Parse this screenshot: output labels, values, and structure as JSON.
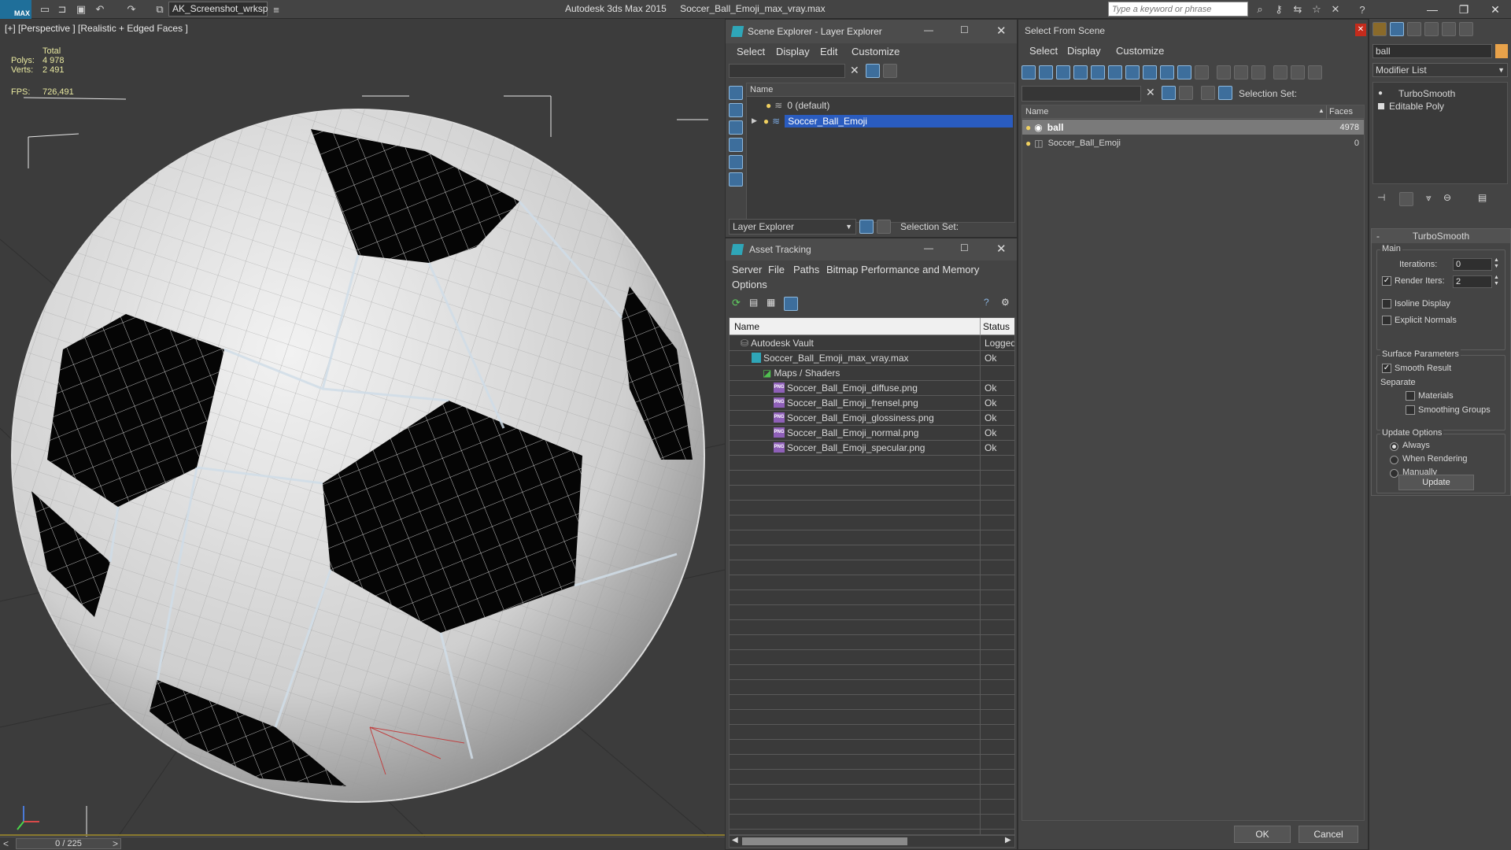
{
  "titlebar": {
    "app_logo": "MAX",
    "workspace": "AK_Screenshot_wrksp",
    "app_title": "Autodesk 3ds Max  2015",
    "file_title": "Soccer_Ball_Emoji_max_vray.max",
    "search_placeholder": "Type a keyword or phrase"
  },
  "viewport": {
    "label": "[+] [Perspective ] [Realistic + Edged Faces ]",
    "stats": {
      "total_label": "Total",
      "polys_label": "Polys:",
      "polys": "4 978",
      "verts_label": "Verts:",
      "verts": "2 491",
      "fps_label": "FPS:",
      "fps": "726,491"
    },
    "timeline": "0 / 225",
    "timeline_prev": "<",
    "timeline_next": ">"
  },
  "scene_explorer": {
    "title": "Scene Explorer - Layer Explorer",
    "menu": [
      "Select",
      "Display",
      "Edit",
      "Customize"
    ],
    "col_name": "Name",
    "layers": [
      "0 (default)",
      "Soccer_Ball_Emoji"
    ],
    "footer_dropdown": "Layer Explorer",
    "selection_set_label": "Selection Set:"
  },
  "asset_tracking": {
    "title": "Asset Tracking",
    "menu": [
      "Server",
      "File",
      "Paths",
      "Bitmap Performance and Memory",
      "Options"
    ],
    "col_name": "Name",
    "col_status": "Status",
    "rows": [
      {
        "name": "Autodesk Vault",
        "status": "Logged",
        "indent": 0,
        "kind": "vault"
      },
      {
        "name": "Soccer_Ball_Emoji_max_vray.max",
        "status": "Ok",
        "indent": 1,
        "kind": "max"
      },
      {
        "name": "Maps / Shaders",
        "status": "",
        "indent": 2,
        "kind": "maps"
      },
      {
        "name": "Soccer_Ball_Emoji_diffuse.png",
        "status": "Ok",
        "indent": 3,
        "kind": "png"
      },
      {
        "name": "Soccer_Ball_Emoji_frensel.png",
        "status": "Ok",
        "indent": 3,
        "kind": "png"
      },
      {
        "name": "Soccer_Ball_Emoji_glossiness.png",
        "status": "Ok",
        "indent": 3,
        "kind": "png"
      },
      {
        "name": "Soccer_Ball_Emoji_normal.png",
        "status": "Ok",
        "indent": 3,
        "kind": "png"
      },
      {
        "name": "Soccer_Ball_Emoji_specular.png",
        "status": "Ok",
        "indent": 3,
        "kind": "png"
      }
    ]
  },
  "select_from_scene": {
    "title": "Select From Scene",
    "menu": [
      "Select",
      "Display",
      "Customize"
    ],
    "selection_set_label": "Selection Set:",
    "col_name": "Name",
    "col_faces": "Faces",
    "rows": [
      {
        "name": "ball",
        "faces": "4978"
      },
      {
        "name": "Soccer_Ball_Emoji",
        "faces": "0"
      }
    ],
    "ok_label": "OK",
    "cancel_label": "Cancel"
  },
  "modify_panel": {
    "object_name": "ball",
    "modifier_list_label": "Modifier List",
    "stack": [
      "TurboSmooth",
      "Editable Poly"
    ],
    "rollout_title": "TurboSmooth",
    "main_label": "Main",
    "iterations_label": "Iterations:",
    "iterations": "0",
    "render_iters_label": "Render Iters:",
    "render_iters": "2",
    "isoline_label": "Isoline Display",
    "explicit_normals_label": "Explicit Normals",
    "surface_params_label": "Surface Parameters",
    "smooth_result_label": "Smooth Result",
    "separate_label": "Separate",
    "materials_label": "Materials",
    "smoothing_groups_label": "Smoothing Groups",
    "update_options_label": "Update Options",
    "always_label": "Always",
    "when_rendering_label": "When Rendering",
    "manually_label": "Manually",
    "update_button": "Update",
    "collapse_sign": "-"
  },
  "colors": {
    "selected_row": "#2a5cc0",
    "panel_bg": "#444444",
    "viewport_bg": "#3c3c3c",
    "accent_orange": "#e8a24a",
    "close_red": "#c42b1c"
  }
}
